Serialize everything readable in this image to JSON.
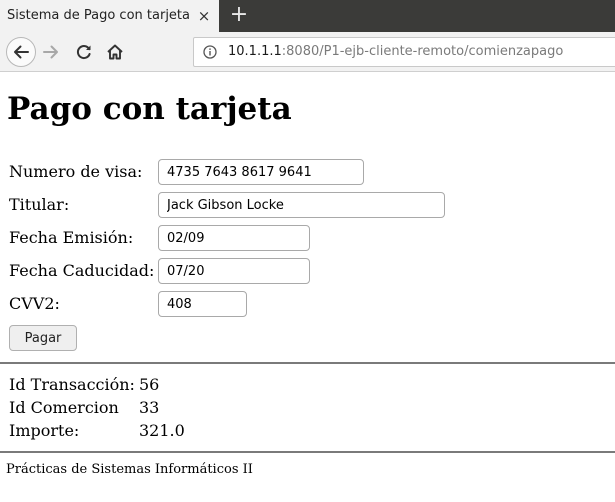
{
  "browser": {
    "tab_title": "Sistema de Pago con tarjeta",
    "tab_close_icon": "×",
    "new_tab_icon": "+",
    "url_host": "10.1.1.1",
    "url_rest": ":8080/P1-ejb-cliente-remoto/comienzapago"
  },
  "page": {
    "title": "Pago con tarjeta"
  },
  "form": {
    "card_number_label": "Numero de visa:",
    "card_number_value": "4735 7643 8617 9641",
    "holder_label": "Titular:",
    "holder_value": "Jack Gibson Locke",
    "issue_date_label": "Fecha Emisión:",
    "issue_date_value": "02/09",
    "expiry_date_label": "Fecha Caducidad:",
    "expiry_date_value": "07/20",
    "cvv_label": "CVV2:",
    "cvv_value": "408",
    "submit_label": "Pagar"
  },
  "results": {
    "transaction_label": "Id Transacción:",
    "transaction_value": "56",
    "commerce_label": "Id Comercion",
    "commerce_value": "33",
    "amount_label": "Importe:",
    "amount_value": "321.0"
  },
  "footer": {
    "text": "Prácticas de Sistemas Informáticos II"
  },
  "colors": {
    "tabbar_bg": "#3b3b39",
    "toolbar_bg": "#f2f2f2",
    "url_host_color": "#1a1a1a",
    "url_path_color": "#7a7a7a"
  }
}
